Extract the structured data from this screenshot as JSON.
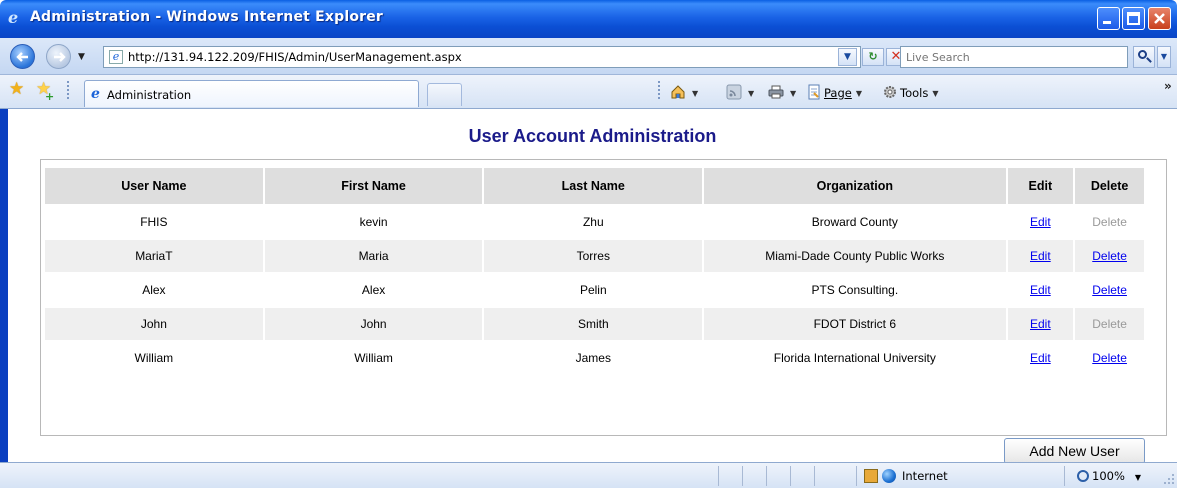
{
  "window": {
    "title": "Administration - Windows Internet Explorer",
    "icon": "ie-logo-icon",
    "controls": [
      "minimize",
      "maximize",
      "close"
    ]
  },
  "addressbar": {
    "url": "http://131.94.122.209/FHIS/Admin/UserManagement.aspx",
    "search_placeholder": "Live Search"
  },
  "tabbar": {
    "active_tab": "Administration",
    "commands": {
      "page": "Page",
      "tools": "Tools"
    }
  },
  "page": {
    "title": "User Account Administration",
    "table": {
      "columns": [
        "User Name",
        "First Name",
        "Last Name",
        "Organization",
        "Edit",
        "Delete"
      ],
      "rows": [
        {
          "user": "FHIS",
          "first": "kevin",
          "last": "Zhu",
          "org": "Broward County",
          "edit": "Edit",
          "delete": "Delete",
          "delete_enabled": false
        },
        {
          "user": "MariaT",
          "first": "Maria",
          "last": "Torres",
          "org": "Miami-Dade County Public Works",
          "edit": "Edit",
          "delete": "Delete",
          "delete_enabled": true
        },
        {
          "user": "Alex",
          "first": "Alex",
          "last": "Pelin",
          "org": "PTS Consulting.",
          "edit": "Edit",
          "delete": "Delete",
          "delete_enabled": true
        },
        {
          "user": "John",
          "first": "John",
          "last": "Smith",
          "org": "FDOT District 6",
          "edit": "Edit",
          "delete": "Delete",
          "delete_enabled": false
        },
        {
          "user": "William",
          "first": "William",
          "last": "James",
          "org": "Florida International University",
          "edit": "Edit",
          "delete": "Delete",
          "delete_enabled": true
        }
      ]
    },
    "add_button": "Add New User"
  },
  "statusbar": {
    "zone": "Internet",
    "zoom": "100%"
  },
  "colors": {
    "titlebar": "#0a45c6",
    "page_title": "#1b1b8a",
    "header_bg": "#dedede",
    "alt_row_bg": "#efefef",
    "link": "#0000ee",
    "disabled": "#999999"
  }
}
